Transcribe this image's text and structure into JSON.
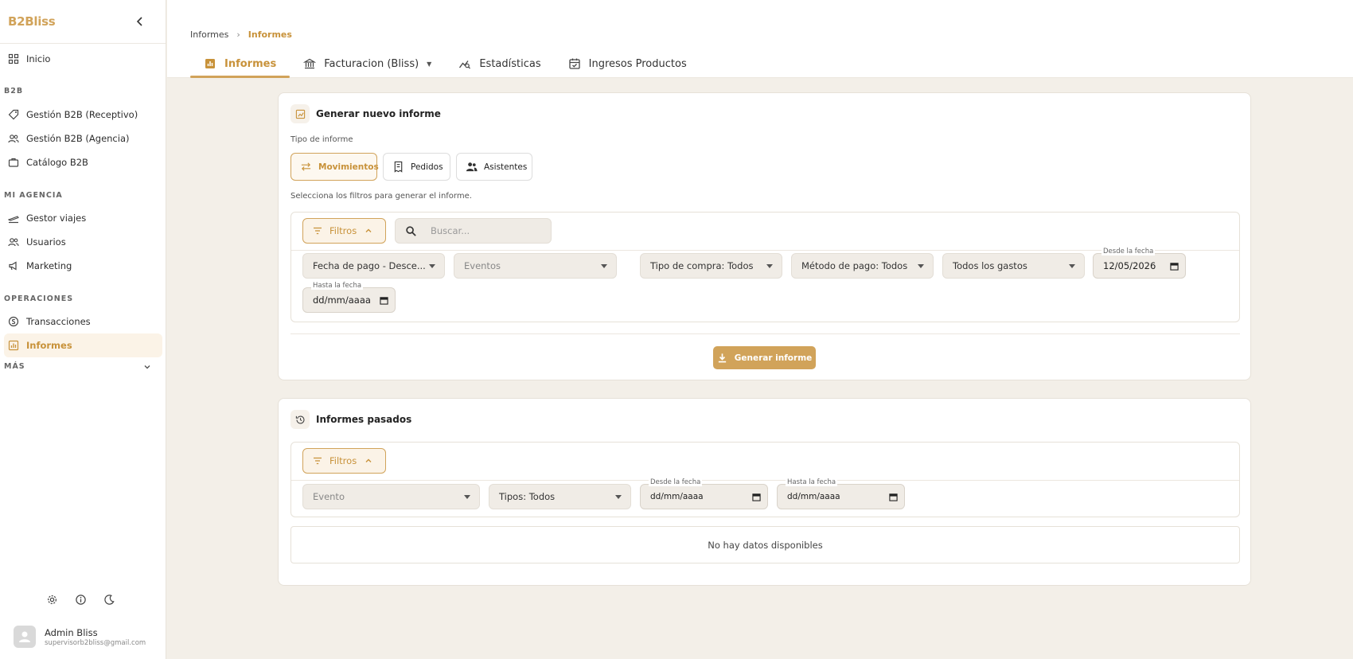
{
  "brand": "B2Bliss",
  "sidebar": {
    "sections": [
      {
        "title": "",
        "items": [
          {
            "label": "Inicio",
            "icon": "grid-icon"
          }
        ]
      },
      {
        "title": "B2B",
        "items": [
          {
            "label": "Gestión B2B (Receptivo)",
            "icon": "tags-icon"
          },
          {
            "label": "Gestión B2B (Agencia)",
            "icon": "users-icon"
          },
          {
            "label": "Catálogo B2B",
            "icon": "briefcase-icon"
          }
        ]
      },
      {
        "title": "MI AGENCIA",
        "items": [
          {
            "label": "Gestor viajes",
            "icon": "plane-icon"
          },
          {
            "label": "Usuarios",
            "icon": "users-icon"
          },
          {
            "label": "Marketing",
            "icon": "megaphone-icon"
          }
        ]
      },
      {
        "title": "OPERACIONES",
        "items": [
          {
            "label": "Transacciones",
            "icon": "coin-icon"
          },
          {
            "label": "Informes",
            "icon": "chart-icon",
            "active": true
          }
        ]
      }
    ],
    "more_label": "MÁS",
    "user": {
      "name": "Admin Bliss",
      "email": "supervisorb2bliss@gmail.com"
    }
  },
  "breadcrumb": {
    "root": "Informes",
    "current": "Informes"
  },
  "tabs": [
    {
      "label": "Informes",
      "icon": "bar-chart-icon",
      "active": true
    },
    {
      "label": "Facturacion (Bliss)",
      "icon": "bank-icon",
      "has_dropdown": true
    },
    {
      "label": "Estadísticas",
      "icon": "trend-icon"
    },
    {
      "label": "Ingresos Productos",
      "icon": "calendar-check-icon"
    }
  ],
  "new_report": {
    "title": "Generar nuevo informe",
    "type_label": "Tipo de informe",
    "types": [
      {
        "label": "Movimientos",
        "icon": "swap-icon",
        "active": true
      },
      {
        "label": "Pedidos",
        "icon": "receipt-icon"
      },
      {
        "label": "Asistentes",
        "icon": "people-icon"
      }
    ],
    "hint": "Selecciona los filtros para generar el informe.",
    "filters_label": "Filtros",
    "search_placeholder": "Buscar...",
    "selects": [
      {
        "value": "Fecha de pago - Desce..."
      },
      {
        "value": "Eventos",
        "placeholder": true
      },
      {
        "value": "Tipo de compra: Todos"
      },
      {
        "value": "Método de pago: Todos"
      },
      {
        "value": "Todos los gastos"
      }
    ],
    "from_date_label": "Desde la fecha",
    "from_date_value": "12/05/2026",
    "to_date_label": "Hasta la fecha",
    "to_date_value": "dd/mm/aaaa",
    "generate_label": "Generar informe"
  },
  "past_reports": {
    "title": "Informes pasados",
    "filters_label": "Filtros",
    "selects": [
      {
        "value": "Evento",
        "placeholder": true
      },
      {
        "value": "Tipos: Todos"
      }
    ],
    "from_date_label": "Desde la fecha",
    "from_date_value": "dd/mm/aaaa",
    "to_date_label": "Hasta la fecha",
    "to_date_value": "dd/mm/aaaa",
    "empty_text": "No hay datos disponibles"
  },
  "colors": {
    "accent": "#d1a35a",
    "background": "#f3efe8"
  }
}
